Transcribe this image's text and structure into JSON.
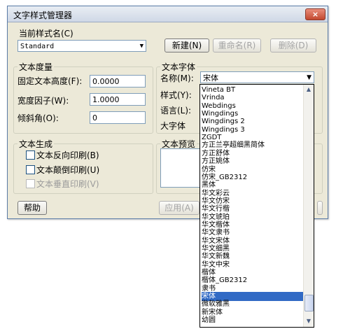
{
  "window": {
    "title": "文字样式管理器",
    "close_label": "×"
  },
  "current_style": {
    "label": "当前样式名(C)",
    "value": "Standard"
  },
  "buttons": {
    "new": "新建(N)",
    "rename": "重命名(R)",
    "delete": "删除(D)",
    "help": "帮助",
    "apply": "应用(A)"
  },
  "text_metrics": {
    "title": "文本度量",
    "fixed_height_label": "固定文本高度(F):",
    "fixed_height_value": "0.0000",
    "width_factor_label": "宽度因子(W):",
    "width_factor_value": "1.0000",
    "oblique_label": "倾斜角(O):",
    "oblique_value": "0"
  },
  "text_font": {
    "title": "文本字体",
    "name_label": "名称(M):",
    "name_value": "宋体",
    "style_label": "样式(Y):",
    "lang_label": "语言(L):",
    "bigfont_label": "大字体"
  },
  "text_gen": {
    "title": "文本生成",
    "backward": "文本反向印刷(B)",
    "upside_down": "文本颠倒印刷(U)",
    "vertical": "文本垂直印刷(V)"
  },
  "preview": {
    "title": "文本预览"
  },
  "font_list": [
    "Vineta BT",
    "Vrinda",
    "Webdings",
    "Wingdings",
    "Wingdings 2",
    "Wingdings 3",
    "ZGDT",
    "方正兰亭超细黑简体",
    "方正舒体",
    "方正姚体",
    "仿宋",
    "仿宋_GB2312",
    "黑体",
    "华文彩云",
    "华文仿宋",
    "华文行楷",
    "华文琥珀",
    "华文楷体",
    "华文隶书",
    "华文宋体",
    "华文细黑",
    "华文新魏",
    "华文中宋",
    "楷体",
    "楷体_GB2312",
    "隶书",
    "宋体",
    "微软雅黑",
    "新宋体",
    "幼圆"
  ],
  "font_list_selected": "宋体"
}
